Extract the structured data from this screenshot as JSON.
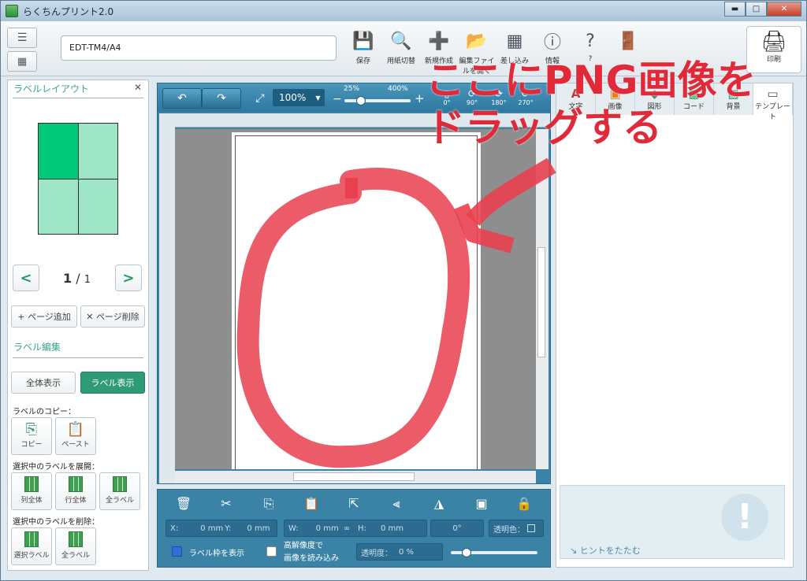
{
  "window": {
    "title": "らくちんプリント2.0",
    "minimize": "▬",
    "maximize": "□",
    "close": "✕"
  },
  "toolbar": {
    "menu_icon": "☰",
    "grid_icon": "▦",
    "model": "EDT-TM4/A4",
    "tools": [
      {
        "label": "保存",
        "icon": "💾"
      },
      {
        "label": "用紙切替",
        "icon": "🔍"
      },
      {
        "label": "新規作成",
        "icon": "➕"
      },
      {
        "label": "編集ファイルを開く",
        "icon": "📂"
      },
      {
        "label": "差し込み",
        "icon": "▦"
      },
      {
        "label": "情報",
        "icon": "ⓘ"
      },
      {
        "label": "?",
        "icon": "?"
      },
      {
        "label": "",
        "icon": "🚪"
      }
    ],
    "print": {
      "label": "印刷",
      "icon": "🖨"
    }
  },
  "left": {
    "title": "ラベルレイアウト",
    "close": "✕",
    "page_current": "1",
    "page_sep": "/",
    "page_total": "1",
    "prev": "<",
    "next": ">",
    "add_page": "+ ページ追加",
    "delete_page": "✕ ページ削除",
    "edit_title": "ラベル編集",
    "view_all": "全体表示",
    "view_label": "ラベル表示",
    "copy_title": "ラベルのコピー：",
    "copy": "コピー",
    "paste": "ペースト",
    "expand_title": "選択中のラベルを展開：",
    "col_all": "列全体",
    "row_all": "行全体",
    "all_labels": "全ラベル",
    "delete_title": "選択中のラベルを削除：",
    "sel_label": "選択ラベル",
    "all_labels2": "全ラベル"
  },
  "canvas": {
    "undo": "↶",
    "redo": "↷",
    "fit": "⤢",
    "zoom": "100%",
    "zoom_min": "25%",
    "zoom_max": "400%",
    "minus": "−",
    "plus": "+",
    "rot0": "0°",
    "rot90": "90°",
    "rot180": "180°",
    "rot270": "270°",
    "zoom_level": 0.25
  },
  "props": {
    "x_label": "X:",
    "x_val": "0 mm",
    "y_label": "Y:",
    "y_val": "0 mm",
    "w_label": "W:",
    "w_val": "0 mm",
    "h_label": "H:",
    "h_val": "0 mm",
    "angle": "0°",
    "transparent_color": "透明色：",
    "show_frame": "ラベル枠を表示",
    "hires_line1": "高解像度で",
    "hires_line2": "画像を読み込み",
    "transparency_label": "透明度：",
    "transparency_val": "0 %",
    "icons": [
      "🗑",
      "✂",
      "⎘",
      "📋",
      "⇱",
      "⫷",
      "◮",
      "▣",
      "🔒"
    ]
  },
  "right": {
    "tabs": [
      {
        "icon": "A",
        "label": "文字",
        "color": "#c0392b"
      },
      {
        "icon": "▣",
        "label": "画像",
        "color": "#e67e22"
      },
      {
        "icon": "◆",
        "label": "図形",
        "color": "#2f8f6f"
      },
      {
        "icon": "▩",
        "label": "コード",
        "color": "#27ae60"
      },
      {
        "icon": "▨",
        "label": "背景",
        "color": "#2f8f6f"
      },
      {
        "icon": "▭",
        "label": "テンプレート",
        "color": "#555"
      }
    ],
    "hint": "ヒントをたたむ",
    "hint_icon": "↘"
  },
  "overlay": {
    "line1": "ここにPNG画像を",
    "line2": "ドラッグする"
  }
}
